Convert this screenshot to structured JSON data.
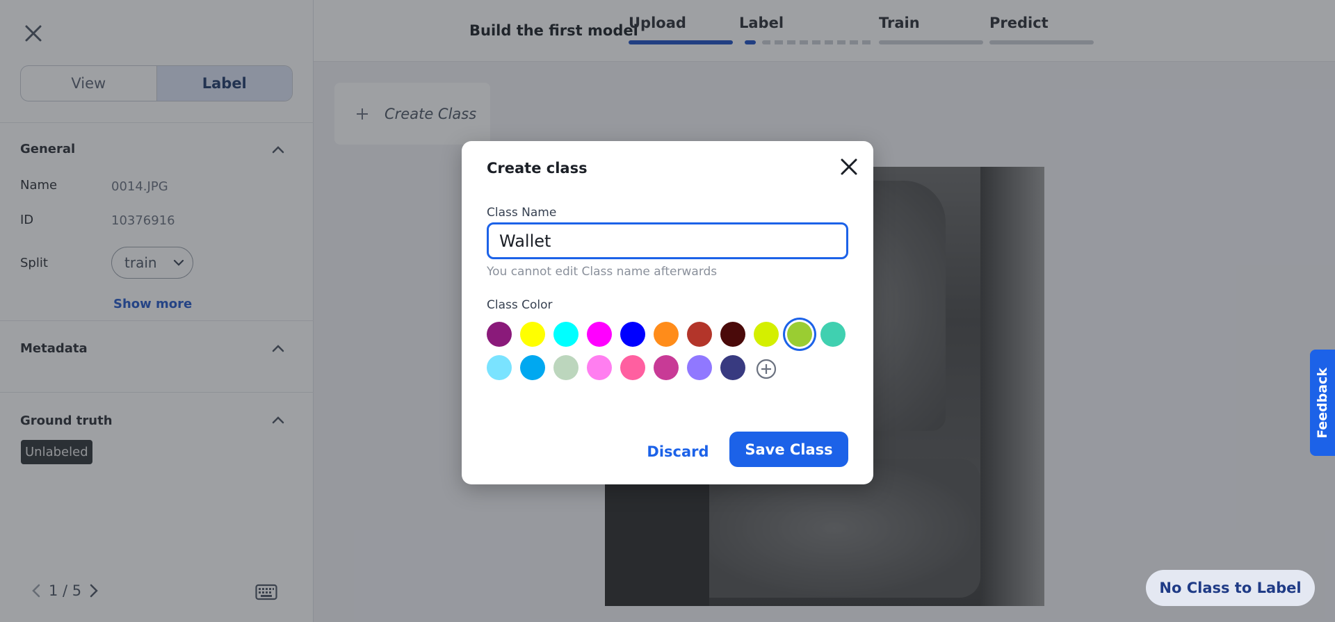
{
  "sidebar": {
    "view_tab": "View",
    "label_tab": "Label",
    "general": {
      "title": "General",
      "name_key": "Name",
      "name_val": "0014.JPG",
      "id_key": "ID",
      "id_val": "10376916",
      "split_key": "Split",
      "split_val": "train",
      "show_more": "Show more"
    },
    "metadata_title": "Metadata",
    "ground_truth": {
      "title": "Ground truth",
      "badge": "Unlabeled"
    },
    "pager": "1 / 5"
  },
  "header": {
    "title": "Build the first model",
    "steps": [
      {
        "label": "Upload"
      },
      {
        "label": "Label"
      },
      {
        "label": "Train"
      },
      {
        "label": "Predict"
      }
    ],
    "accent": "#1c4fc4"
  },
  "main": {
    "create_class_tile": "Create Class",
    "feedback": "Feedback",
    "no_class": "No Class to Label"
  },
  "modal": {
    "title": "Create class",
    "class_name_label": "Class Name",
    "class_name_value": "Wallet",
    "hint": "You cannot edit Class name afterwards",
    "class_color_label": "Class Color",
    "colors": [
      "#8a1a7a",
      "#ffff00",
      "#00ffff",
      "#ff00ff",
      "#0000ff",
      "#ff8c1a",
      "#b3352a",
      "#4a0a0a",
      "#d4ef00",
      "#9acd32",
      "#40d0b0",
      "#7ae3ff",
      "#00a8f0",
      "#bcd6bd",
      "#ff7ef0",
      "#ff5fa0",
      "#c83a96",
      "#9078ff",
      "#383a80"
    ],
    "selected_color": "#9acd32",
    "discard": "Discard",
    "save": "Save Class"
  }
}
